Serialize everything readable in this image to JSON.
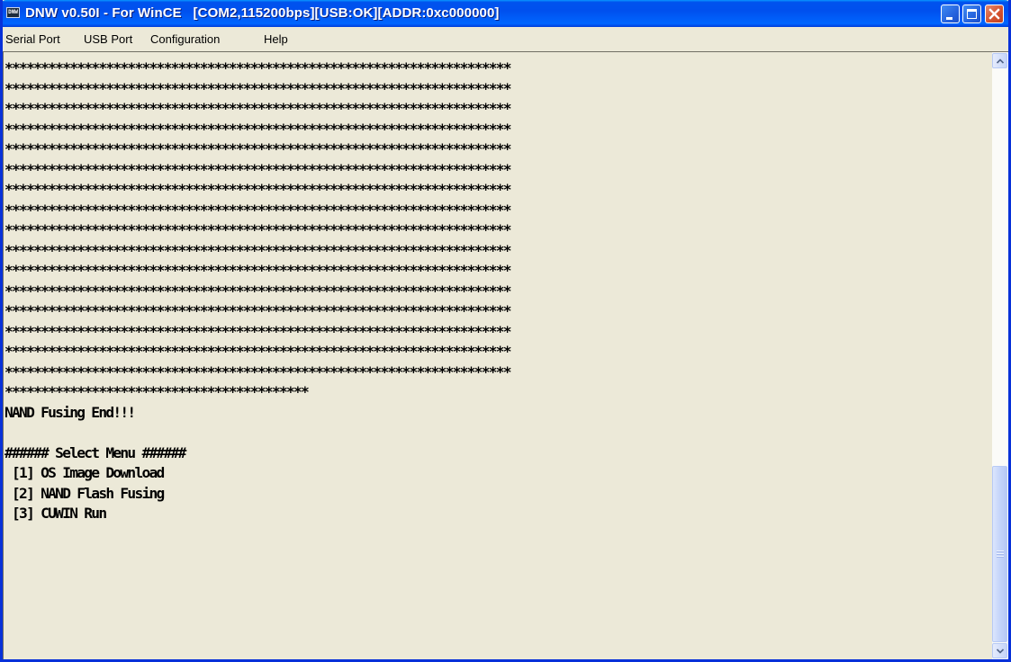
{
  "window": {
    "title": "DNW v0.50I - For WinCE   [COM2,115200bps][USB:OK][ADDR:0xc000000]",
    "icon_name": "dnw-app-icon",
    "icon_text": "DNW",
    "buttons": [
      "minimize-icon",
      "maximize-icon",
      "close-icon"
    ]
  },
  "menu": {
    "items": [
      "Serial Port",
      "USB Port",
      "Configuration",
      "Help"
    ]
  },
  "terminal": {
    "lines": [
      "**********************************************************************",
      "**********************************************************************",
      "**********************************************************************",
      "**********************************************************************",
      "**********************************************************************",
      "**********************************************************************",
      "**********************************************************************",
      "**********************************************************************",
      "**********************************************************************",
      "**********************************************************************",
      "**********************************************************************",
      "**********************************************************************",
      "**********************************************************************",
      "**********************************************************************",
      "**********************************************************************",
      "**********************************************************************",
      "******************************************",
      "NAND Fusing End!!!",
      "",
      "###### Select Menu ######",
      " [1] OS Image Download",
      " [2] NAND Flash Fusing",
      " [3] CUWIN Run"
    ]
  },
  "colors": {
    "titlebar": "#0054e3",
    "background": "#ece9d8",
    "text": "#000000",
    "close_button": "#d5532f"
  }
}
